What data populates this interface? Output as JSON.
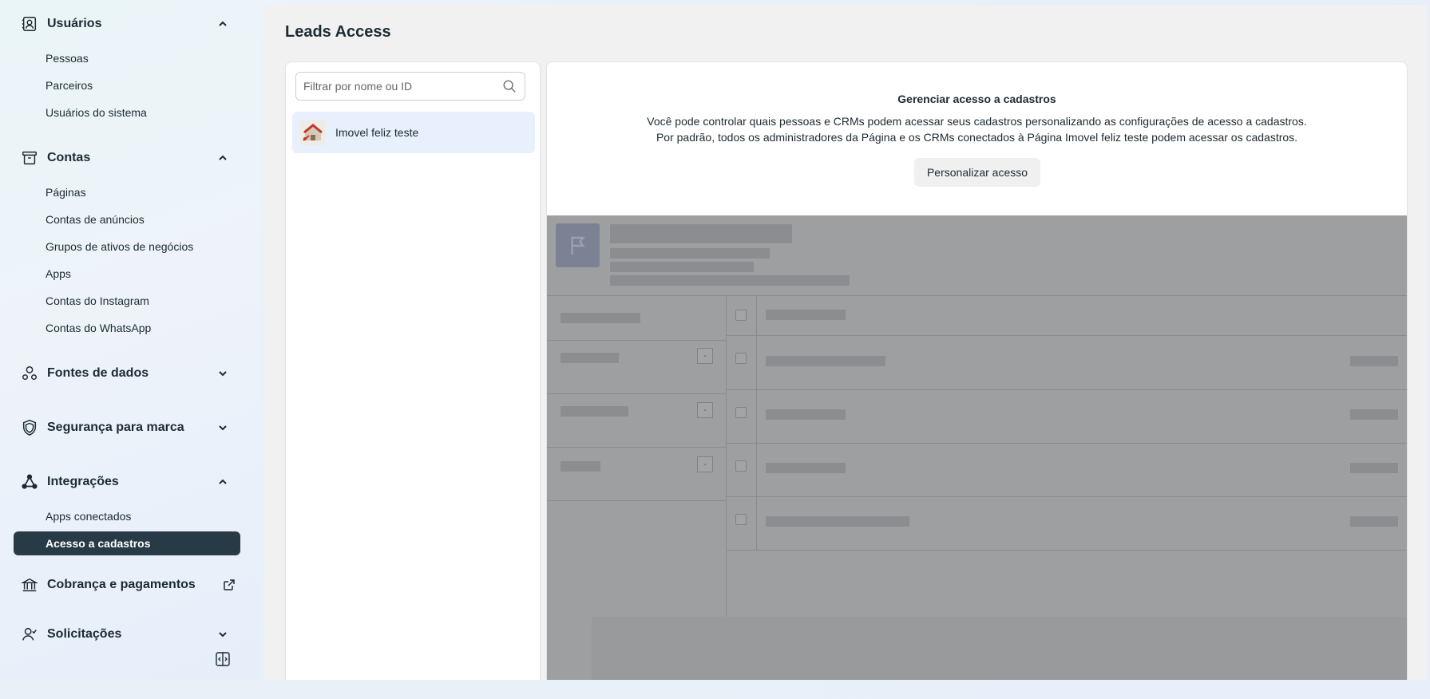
{
  "sidebar": {
    "sections": [
      {
        "id": "usuarios",
        "title": "Usuários",
        "icon": "contact-card-icon",
        "expanded": true,
        "items": [
          "Pessoas",
          "Parceiros",
          "Usuários do sistema"
        ]
      },
      {
        "id": "contas",
        "title": "Contas",
        "icon": "archive-box-icon",
        "expanded": true,
        "items": [
          "Páginas",
          "Contas de anúncios",
          "Grupos de ativos de negócios",
          "Apps",
          "Contas do Instagram",
          "Contas do WhatsApp"
        ]
      },
      {
        "id": "fontes",
        "title": "Fontes de dados",
        "icon": "data-sources-icon",
        "expanded": false,
        "items": []
      },
      {
        "id": "seguranca",
        "title": "Segurança para marca",
        "icon": "shield-icon",
        "expanded": false,
        "items": []
      },
      {
        "id": "integracoes",
        "title": "Integrações",
        "icon": "integrations-icon",
        "expanded": true,
        "items": [
          "Apps conectados",
          "Acesso a cadastros"
        ],
        "active_item": "Acesso a cadastros"
      },
      {
        "id": "cobranca",
        "title": "Cobrança e pagamentos",
        "icon": "bank-icon",
        "expanded": false,
        "external": true,
        "items": []
      },
      {
        "id": "solicitacoes",
        "title": "Solicitações",
        "icon": "person-check-icon",
        "expanded": false,
        "items": []
      }
    ]
  },
  "main": {
    "title": "Leads Access",
    "search": {
      "placeholder": "Filtrar por nome ou ID",
      "value": ""
    },
    "pages": [
      {
        "name": "Imovel feliz teste",
        "selected": true
      }
    ],
    "manage": {
      "title": "Gerenciar acesso a cadastros",
      "line1": "Você pode controlar quais pessoas e CRMs podem acessar seus cadastros personalizando as configurações de acesso a cadastros.",
      "line2": "Por padrão, todos os administradores da Página e os CRMs conectados à Página Imovel feliz teste podem acessar os cadastros.",
      "button": "Personalizar acesso"
    }
  },
  "colors": {
    "active_nav_bg": "#283a46",
    "selected_item_bg": "#e7f0fc",
    "overlay_gray": "#9e9fa1"
  }
}
